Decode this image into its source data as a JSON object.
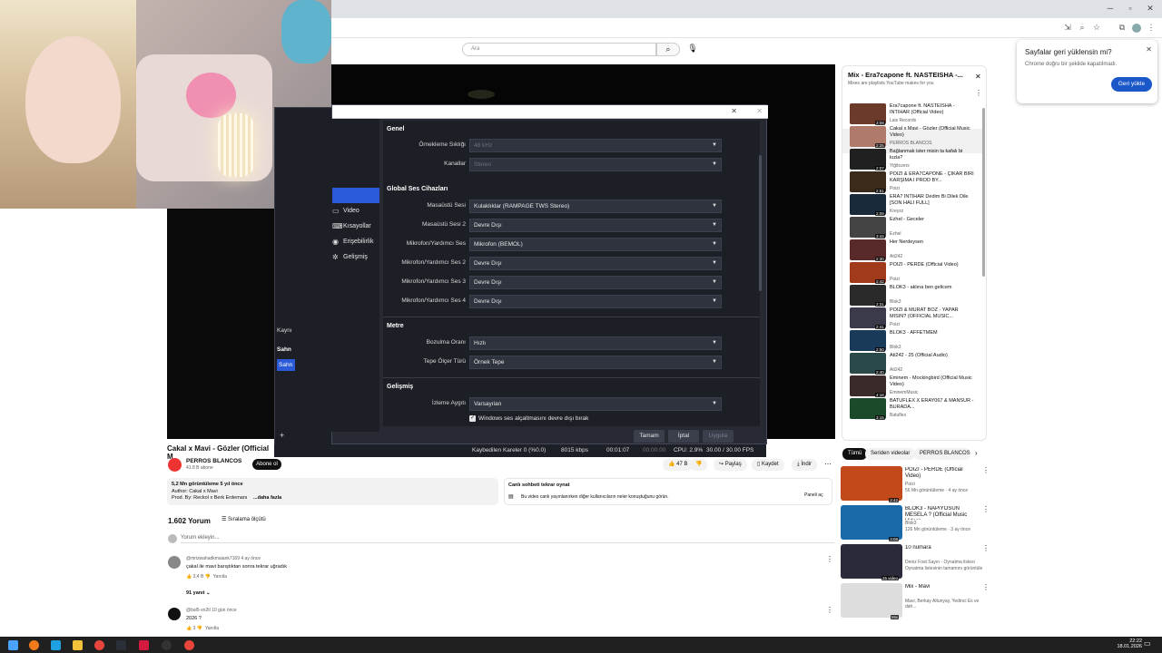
{
  "browser": {
    "search_placeholder": "Ara"
  },
  "restore_popup": {
    "title": "Sayfalar geri yüklensin mi?",
    "text": "Chrome doğru bir şekilde kapatılmadı.",
    "button": "Geri yükle"
  },
  "obs": {
    "sidebar": [
      "Video",
      "Kısayollar",
      "Erişebilirlik",
      "Gelişmiş"
    ],
    "sections": {
      "general": "Genel",
      "global_audio": "Global Ses Cihazları",
      "meters": "Metre",
      "advanced": "Gelişmiş"
    },
    "rows": {
      "sample_rate": {
        "label": "Örnekleme Sıklığı",
        "value": "48 kHz"
      },
      "channels": {
        "label": "Kanallar",
        "value": "Stereo"
      },
      "desktop_audio": {
        "label": "Masaüstü Sesi",
        "value": "Kulaklıklar (RAMPAGE TWS Stereo)"
      },
      "desktop_audio_2": {
        "label": "Masaüstü Sesi 2",
        "value": "Devre Dışı"
      },
      "mic": {
        "label": "Mikrofon/Yardımcı Ses",
        "value": "Mikrofon (BEMOL)"
      },
      "mic_2": {
        "label": "Mikrofon/Yardımcı Ses 2",
        "value": "Devre Dışı"
      },
      "mic_3": {
        "label": "Mikrofon/Yardımcı Ses 3",
        "value": "Devre Dışı"
      },
      "mic_4": {
        "label": "Mikrofon/Yardımcı Ses 4",
        "value": "Devre Dışı"
      },
      "decay": {
        "label": "Bozulma Oranı",
        "value": "Hızlı"
      },
      "peak": {
        "label": "Tepe Ölçer Türü",
        "value": "Örnek Tepe"
      },
      "monitoring": {
        "label": "İzleme Aygıtı",
        "value": "Varsayılan"
      }
    },
    "checkbox_label": "Windows ses alçaltmasını devre dışı bırak",
    "buttons": {
      "ok": "Tamam",
      "cancel": "İptal",
      "apply": "Uygula"
    },
    "dock_labels": {
      "sources": "Kaynı",
      "scenes": "Sahn",
      "scene_item": "Sahn"
    },
    "status": {
      "dropped": "Kaybedilen Kareler 0 (%0.0)",
      "bitrate": "8015 kbps",
      "stream_time": "00:01:07",
      "rec_time": "00:00:00",
      "cpu": "CPU: 2.9%",
      "fps": "30.00 / 30.00 FPS"
    }
  },
  "video": {
    "title": "Cakal x Mavi - Gözler (Official M",
    "channel": "PERROS BLANCOS",
    "subs": "41.8 B abone",
    "subscribe": "Abone ol",
    "likes": "47 B",
    "share": "Paylaş",
    "save": "Kaydet",
    "download": "İndir",
    "desc_views": "5,2 Mn görüntüleme  5 yıl önce",
    "desc_line1": "Author: Cakal x Mavi",
    "desc_line2": "Prod. By: Reckol x Berk Erdemanı",
    "desc_more": "...daha fazla",
    "chat_title": "Canlı sohbeti tekrar oynat",
    "chat_text": "Bu video canlı yayınlanırken diğer kullanıcıların neler konuştuğunu görün.",
    "chat_close": "Paneli aç"
  },
  "comments": {
    "count": "1.602 Yorum",
    "sort": "Sıralama ölçütü",
    "add": "Yorum ekleyin...",
    "items": [
      {
        "author": "@mrizwahadkmaiank7169",
        "time": "4 ay önce",
        "text": "çakal ile mavi barıştıktan sonra tekrar uğradık",
        "likes": "3,4 B",
        "reply": "Yanıtla"
      },
      {
        "author": "@bal5-xn2tl",
        "time": "10 gün önce",
        "text": "2026 ?",
        "likes": "3",
        "reply": "Yanıtla"
      }
    ],
    "replies": "91 yanıt"
  },
  "playlist": {
    "title": "Mix - Era7capone ft. NASTEISHA -...",
    "subtitle": "Mixes are playlists YouTube makes for you",
    "items": [
      {
        "title": "Era7capone ft. NASTEISHA - INTIHAR (Official Video)",
        "channel": "Lais Records",
        "dur": "3:08"
      },
      {
        "title": "Cakal x Mavi - Gözler (Official Music Video)",
        "channel": "PERROS BLANCOS",
        "dur": "2:25"
      },
      {
        "title": "Bağlanmak ister misin ta kafalı bi kızla?",
        "channel": "Yiğitozers",
        "dur": "2:07"
      },
      {
        "title": "POIZI & ERA7CAPONE - ÇIKAR BIRI KARŞIMA I PROD BY...",
        "channel": "Poizi",
        "dur": "2:51"
      },
      {
        "title": "ERA7 INTIHAR Dedim Bi Dilek Dile [SON HALI FULL]",
        "channel": "Kreyzz",
        "dur": "2:09"
      },
      {
        "title": "Ezhel - Geceler",
        "channel": "Ezhel",
        "dur": "3:44"
      },
      {
        "title": "Her Nerdeysen",
        "channel": "Ati242",
        "dur": "2:30"
      },
      {
        "title": "POIZI - PERDE (Official Video)",
        "channel": "Poizi",
        "dur": "2:42"
      },
      {
        "title": "BLOK3 - aklına ben gelicem",
        "channel": "Blok3",
        "dur": "2:31"
      },
      {
        "title": "POIZI & MURAT BOZ - YAPAR MISIN? (OFFICIAL MUSIC...",
        "channel": "Poizi",
        "dur": "2:41"
      },
      {
        "title": "BLOK3 - AFFETMEM",
        "channel": "Blok3",
        "dur": "2:50"
      },
      {
        "title": "Ati242 - 25 (Official Audio)",
        "channel": "Ati242",
        "dur": "2:40"
      },
      {
        "title": "Eminem - Mockingbird (Official Music Video)",
        "channel": "EminemMusic",
        "dur": "4:18"
      },
      {
        "title": "BATUFLEX X ERAY067 & MANSUR - BURADA...",
        "channel": "Batuflex",
        "dur": "3:15"
      }
    ]
  },
  "chips": [
    "Tümü",
    "Seriden videolar",
    "PERROS BLANCOS ..."
  ],
  "recommended": [
    {
      "title": "POIZI - PERDE (Official Video)",
      "sub1": "Poizi",
      "sub2": "56 Mn görüntüleme · 4 ay önce",
      "dur": "2:42"
    },
    {
      "title": "BLOK3 - NAPIYOSUN MESELA ? (Official Music Video)",
      "sub1": "Blok3",
      "sub2": "126 Mn görüntüleme · 3 ay önce",
      "dur": "3:08"
    },
    {
      "title": "10 numara",
      "sub1": "Deniz Fost Sayın - Oynatma listesi",
      "sub2": "Oynatma listesinin tamamını görüntüle",
      "dur": "25 video"
    },
    {
      "title": "Mix - Mavi",
      "sub1": "Mavi, Berkay Altunyay, Yedinci Es ve dah...",
      "sub2": "",
      "dur": "Mix"
    }
  ],
  "taskbar": {
    "time": "22:22",
    "date": "18.01.2026"
  }
}
